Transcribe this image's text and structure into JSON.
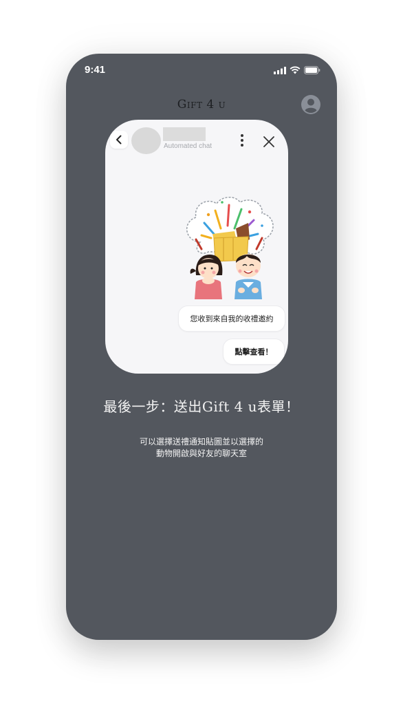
{
  "status_bar": {
    "time": "9:41"
  },
  "header": {
    "title": "Gift 4 u"
  },
  "chat_preview": {
    "subtitle": "Automated chat",
    "messages": [
      {
        "text": "您收到來自我的收禮邀約"
      },
      {
        "text": "點擊查看！"
      }
    ]
  },
  "step": {
    "title": "最後一步：送出Gift 4 u表單！",
    "description_line1": "可以選擇送禮通知貼圖並以選擇的",
    "description_line2": "動物開啟與好友的聊天室"
  },
  "colors": {
    "phone_bg": "#53575e",
    "card_bg": "#f6f6f8"
  }
}
